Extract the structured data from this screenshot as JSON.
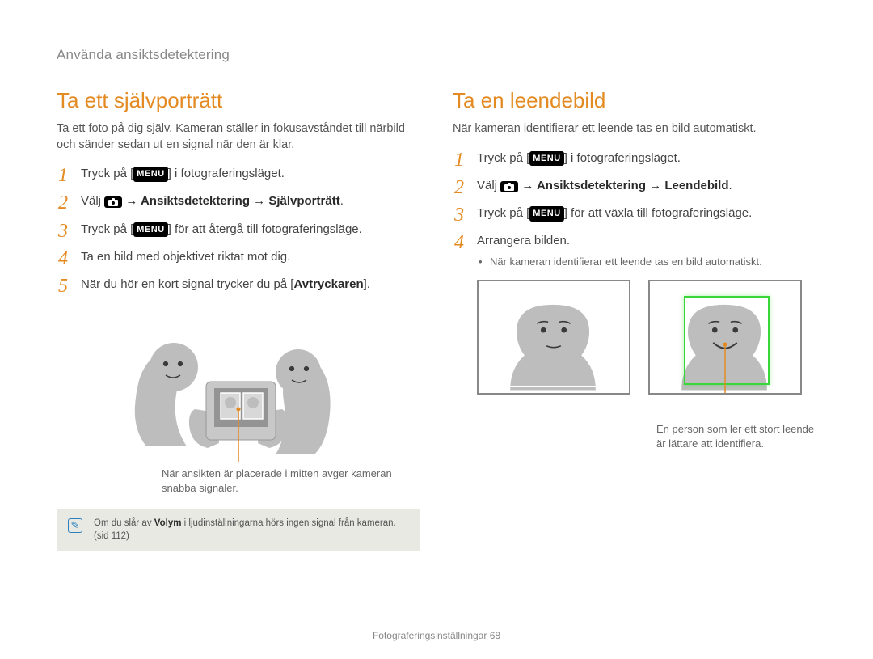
{
  "breadcrumb": "Använda ansiktsdetektering",
  "left": {
    "title": "Ta ett självporträtt",
    "intro": "Ta ett foto på dig själv. Kameran ställer in fokusavståndet till närbild och sänder sedan ut en signal när den är klar.",
    "steps": {
      "s1a": "Tryck på [",
      "s1b": "] i fotograferingsläget.",
      "s2a": "Välj ",
      "s2b": " → Ansiktsdetektering → Självporträtt",
      "s2c": ".",
      "s3a": "Tryck på [",
      "s3b": "] för att återgå till fotograferingsläge.",
      "s4": "Ta en bild med objektivet riktat mot dig.",
      "s5a": "När du hör en kort signal trycker du på [",
      "s5b": "Avtryckaren",
      "s5c": "]."
    },
    "callout": "När ansikten är placerade i mitten avger kameran snabba signaler.",
    "note_a": "Om du slår av ",
    "note_b": "Volym",
    "note_c": " i ljudinställningarna hörs ingen signal från kameran. (sid 112)",
    "menu_label": "MENU"
  },
  "right": {
    "title": "Ta en leendebild",
    "intro": "När kameran identifierar ett leende tas en bild automatiskt.",
    "steps": {
      "s1a": "Tryck på [",
      "s1b": "] i fotograferingsläget.",
      "s2a": "Välj ",
      "s2b": " → Ansiktsdetektering → Leendebild",
      "s2c": ".",
      "s3a": "Tryck på [",
      "s3b": "] för att växla till fotograferingsläge.",
      "s4": "Arrangera bilden.",
      "s4_sub": "När kameran identifierar ett leende tas en bild automatiskt."
    },
    "callout": "En person som ler ett stort leende är lättare att identifiera."
  },
  "footer_a": "Fotograferingsinställningar",
  "footer_b": "  68"
}
